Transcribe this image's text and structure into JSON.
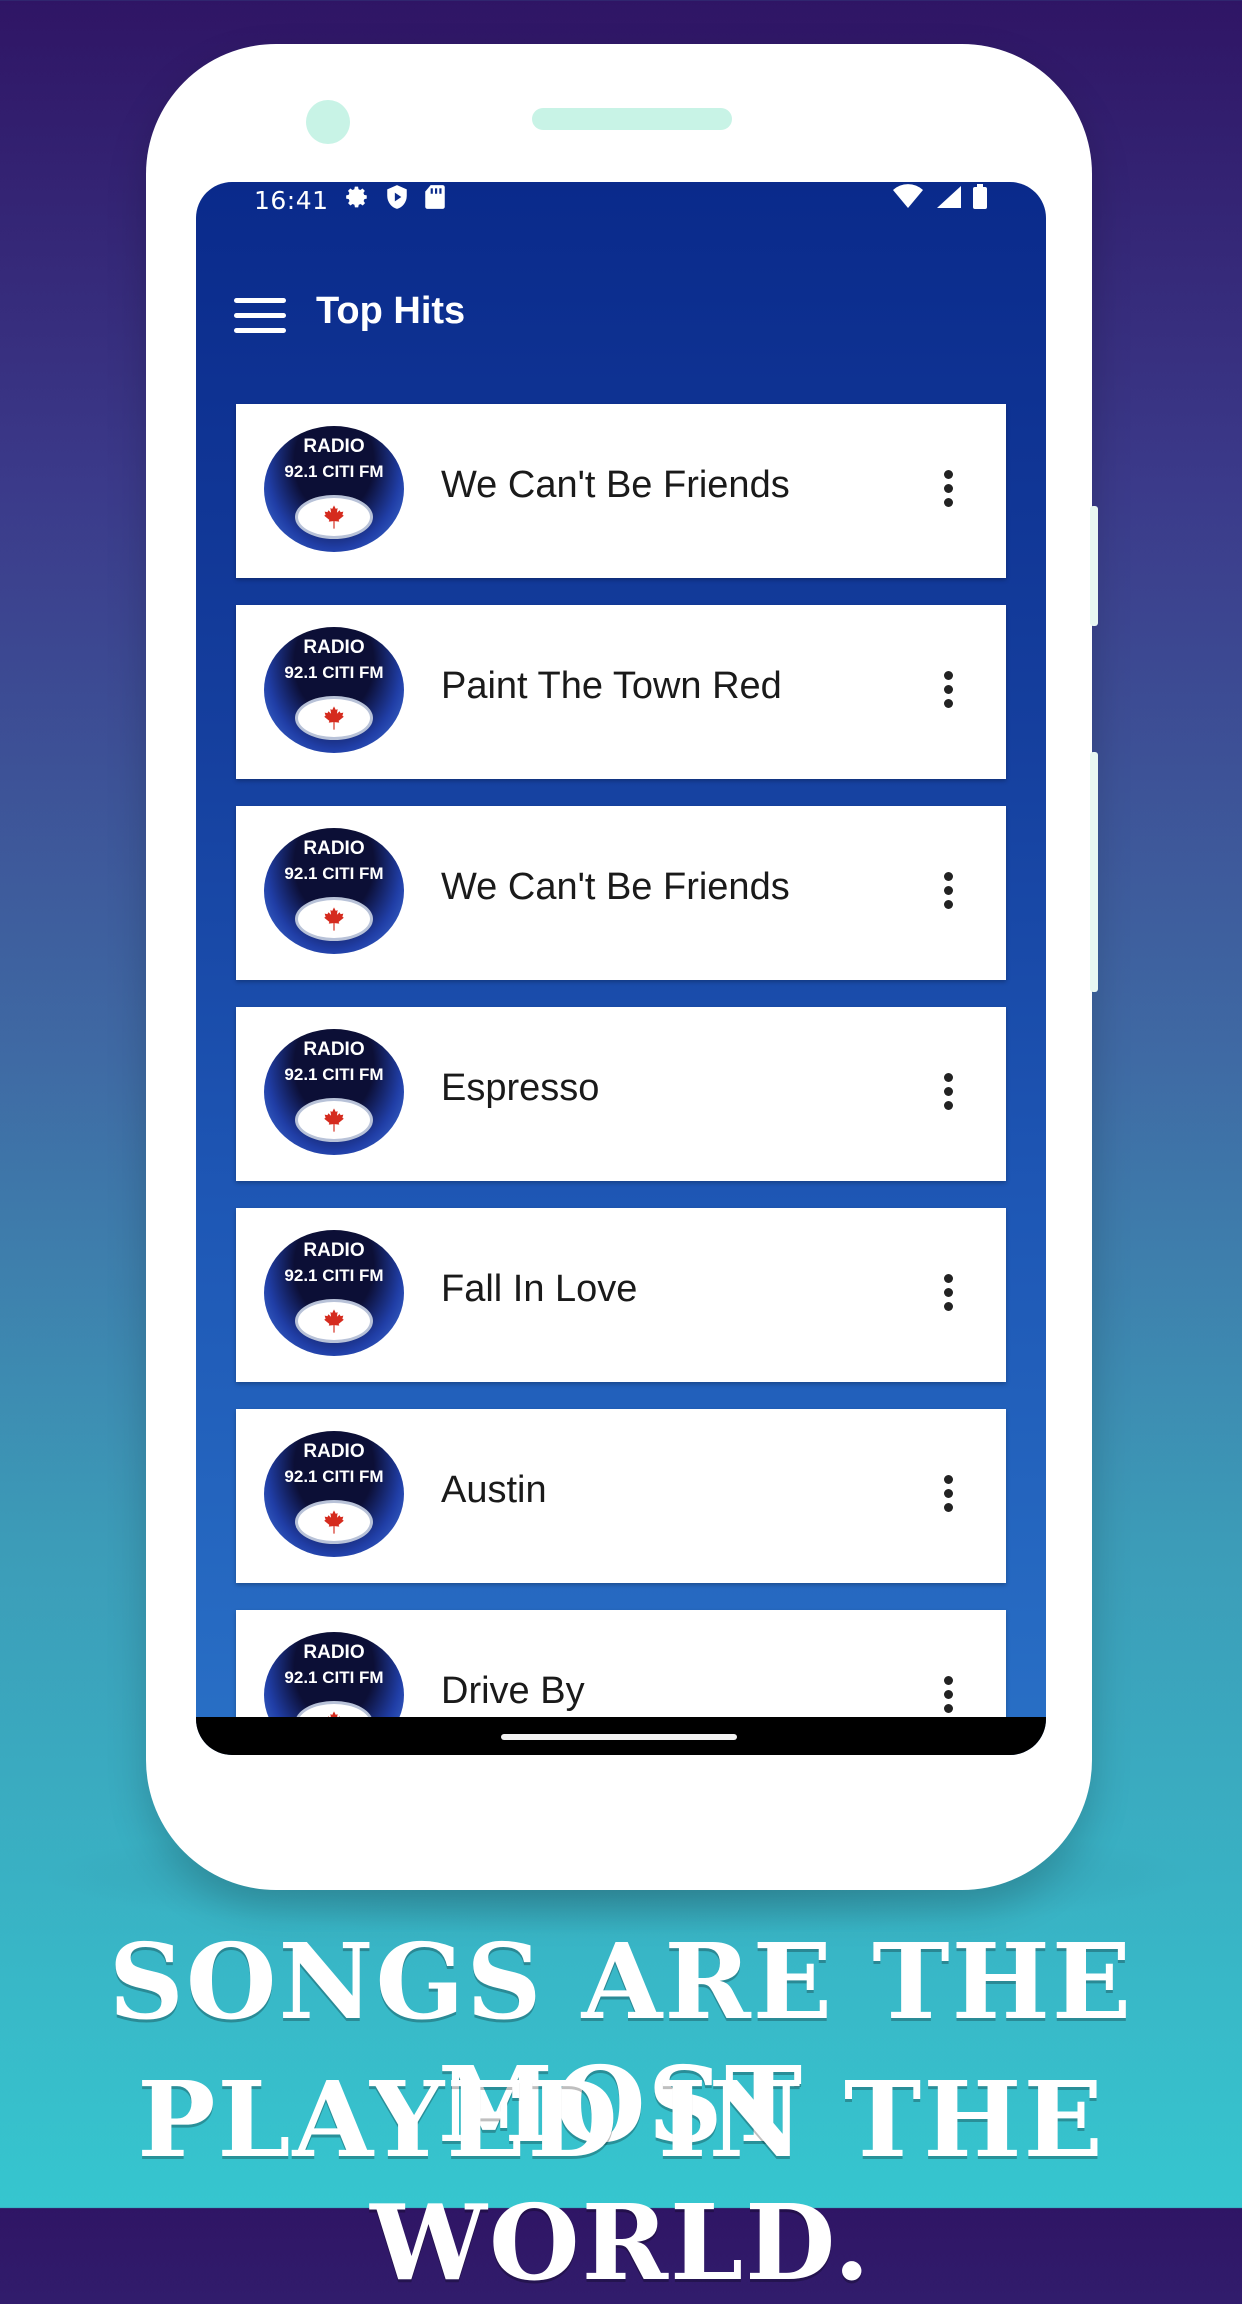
{
  "status_bar": {
    "time": "16:41"
  },
  "app_bar": {
    "title": "Top Hits"
  },
  "logo": {
    "line1": "RADIO",
    "line2": "92.1 CITI FM"
  },
  "songs": [
    {
      "title": "We Can't Be Friends"
    },
    {
      "title": "Paint The Town Red"
    },
    {
      "title": "We Can't Be Friends"
    },
    {
      "title": "Espresso"
    },
    {
      "title": "Fall In Love"
    },
    {
      "title": "Austin"
    },
    {
      "title": "Drive By"
    }
  ],
  "caption": {
    "line1": "SONGS ARE THE MOST",
    "line2": "PLAYED IN THE WORLD."
  },
  "colors": {
    "app_bar": "#0a2a8b",
    "background_top": "#2f1565",
    "background_bottom": "#36c6cf"
  }
}
